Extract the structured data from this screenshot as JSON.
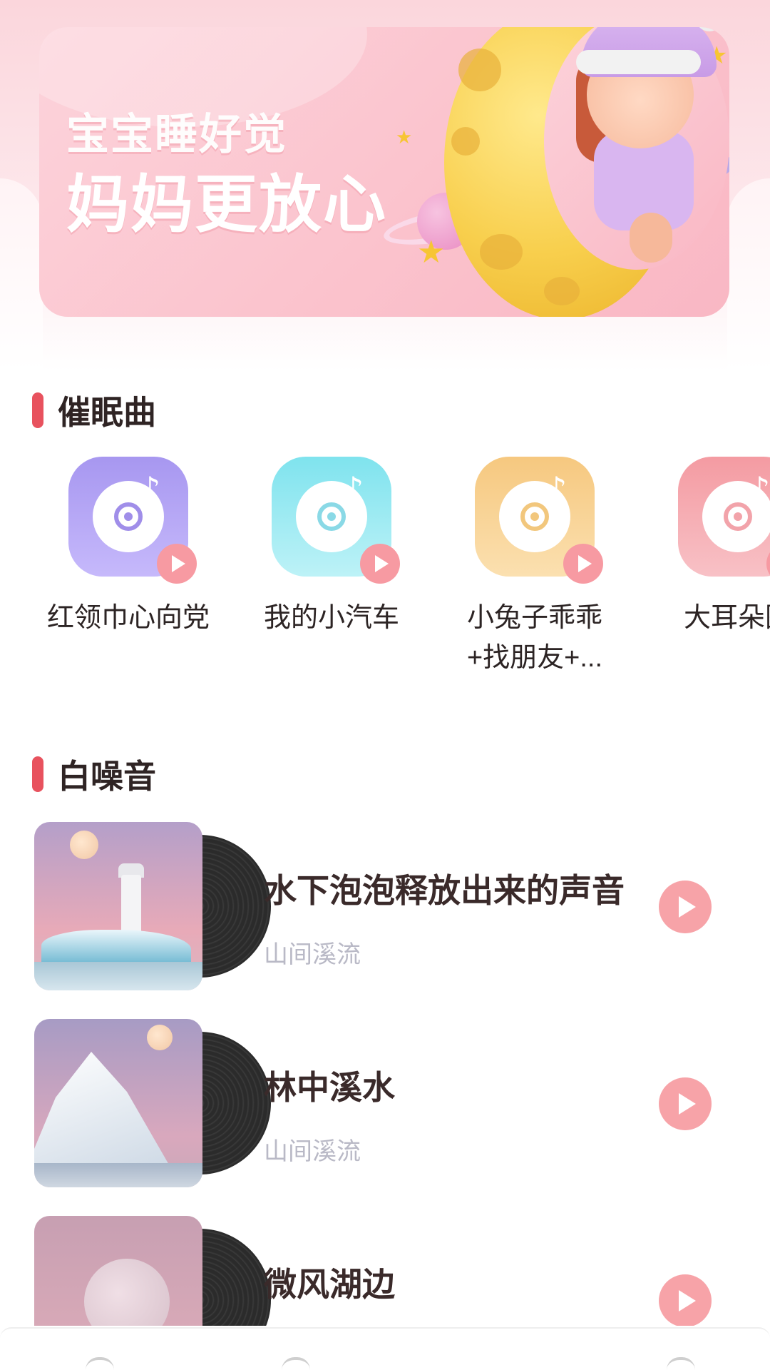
{
  "banner": {
    "line1": "宝宝睡好觉",
    "line2": "妈妈更放心"
  },
  "lullaby": {
    "title": "催眠曲",
    "items": [
      {
        "label": "红领巾心向党",
        "color_top": "#a797f0",
        "color_bottom": "#c6b9fb",
        "accent": "#a08ee9"
      },
      {
        "label": "我的小汽车",
        "color_top": "#7fe3ee",
        "color_bottom": "#bdf2f7",
        "accent": "#8ad9e6"
      },
      {
        "label": "小兔子乖乖+找朋友+...",
        "color_top": "#f6c87f",
        "color_bottom": "#fbe0b0",
        "accent": "#f2c77d"
      },
      {
        "label": "大耳朵图",
        "color_top": "#f49ba2",
        "color_bottom": "#f8c1c6",
        "accent": "#f2a3aa"
      }
    ]
  },
  "white_noise": {
    "title": "白噪音",
    "items": [
      {
        "title": "水下泡泡释放出来的声音",
        "subtitle": "山间溪流"
      },
      {
        "title": "林中溪水",
        "subtitle": "山间溪流"
      },
      {
        "title": "微风湖边",
        "subtitle": ""
      }
    ]
  },
  "colors": {
    "accent_red": "#e8525e",
    "play_pink": "#f7a3a8"
  }
}
